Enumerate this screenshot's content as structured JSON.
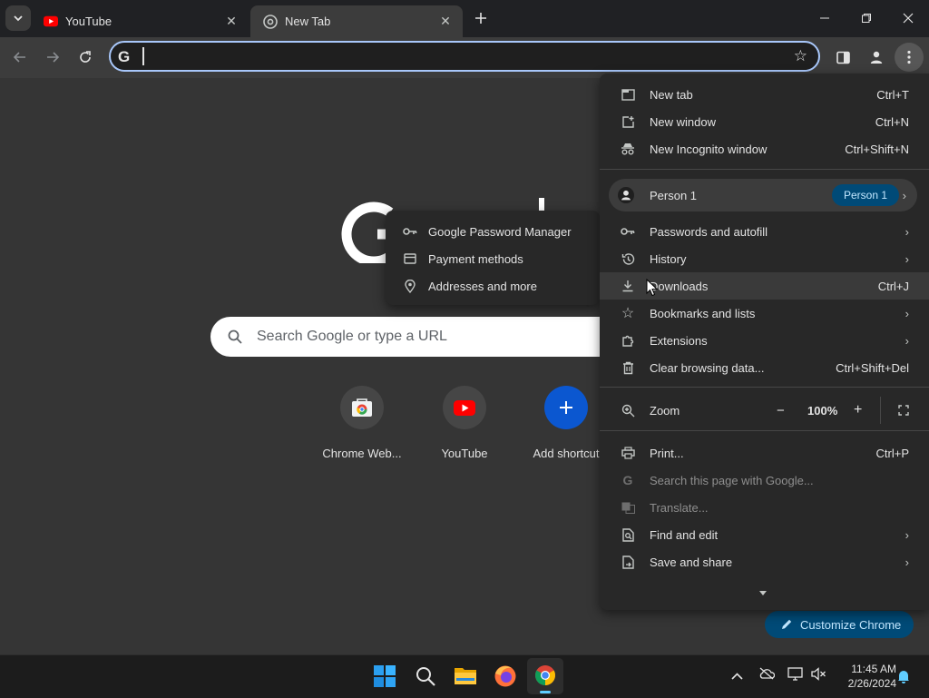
{
  "colors": {
    "accent": "#a8c7fa",
    "badge_bg": "#004a77",
    "badge_text": "#c2e7ff",
    "youtube_red": "#ff0000",
    "add_shortcut": "#0b57d0"
  },
  "tabs": [
    {
      "title": "YouTube",
      "icon": "youtube-icon"
    },
    {
      "title": "New Tab",
      "icon": "chrome-icon"
    }
  ],
  "omnibox": {
    "value": "",
    "icon": "google-g-icon"
  },
  "ntp": {
    "search_placeholder": "Search Google or type a URL",
    "shortcuts": [
      {
        "label": "Chrome Web...",
        "icon": "chrome-web-store-icon"
      },
      {
        "label": "YouTube",
        "icon": "youtube-icon"
      },
      {
        "label": "Add shortcut",
        "icon": "plus-icon"
      }
    ],
    "customize_label": "Customize Chrome"
  },
  "menu": {
    "new_tab": {
      "label": "New tab",
      "shortcut": "Ctrl+T"
    },
    "new_window": {
      "label": "New window",
      "shortcut": "Ctrl+N"
    },
    "incognito": {
      "label": "New Incognito window",
      "shortcut": "Ctrl+Shift+N"
    },
    "profile": {
      "label": "Person 1",
      "badge": "Person 1"
    },
    "passwords": {
      "label": "Passwords and autofill"
    },
    "history": {
      "label": "History"
    },
    "downloads": {
      "label": "Downloads",
      "shortcut": "Ctrl+J"
    },
    "bookmarks": {
      "label": "Bookmarks and lists"
    },
    "extensions": {
      "label": "Extensions"
    },
    "clear": {
      "label": "Clear browsing data...",
      "shortcut": "Ctrl+Shift+Del"
    },
    "zoom": {
      "label": "Zoom",
      "value": "100%",
      "minus": "−",
      "plus": "+"
    },
    "print": {
      "label": "Print...",
      "shortcut": "Ctrl+P"
    },
    "search_page": {
      "label": "Search this page with Google..."
    },
    "translate": {
      "label": "Translate..."
    },
    "find_edit": {
      "label": "Find and edit"
    },
    "save_share": {
      "label": "Save and share"
    }
  },
  "submenu": {
    "items": [
      {
        "label": "Google Password Manager",
        "icon": "key-icon"
      },
      {
        "label": "Payment methods",
        "icon": "credit-card-icon"
      },
      {
        "label": "Addresses and more",
        "icon": "location-pin-icon"
      }
    ]
  },
  "taskbar": {
    "time": "11:45 AM",
    "date": "2/26/2024"
  }
}
